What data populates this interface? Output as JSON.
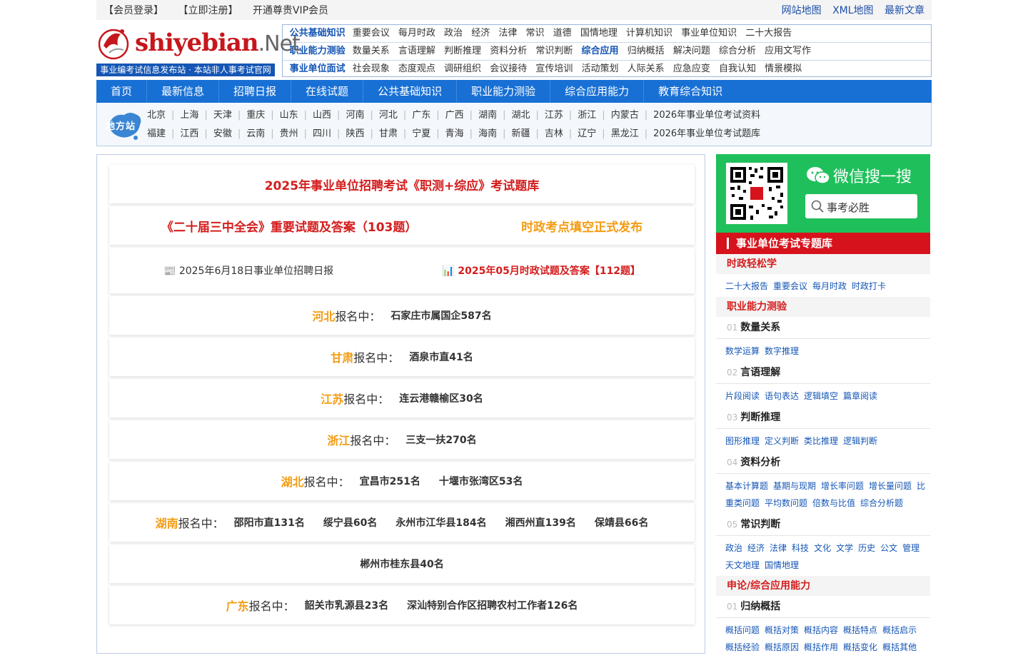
{
  "topbar": {
    "left": [
      "【会员登录】",
      "【立即注册】",
      "开通尊贵VIP会员"
    ],
    "right": [
      "网站地图",
      "XML地图",
      "最新文章"
    ]
  },
  "logo": {
    "main": "shiyebian",
    "suffix": ".Net",
    "subtitle": "事业编考试信息发布站 · 本站非人事考试官网"
  },
  "quicknav": [
    {
      "head": "公共基础知识",
      "items": [
        "重要会议",
        "每月时政",
        "政治",
        "经济",
        "法律",
        "常识",
        "道德",
        "国情地理",
        "计算机知识",
        "事业单位知识",
        "二十大报告"
      ]
    },
    {
      "head": "职业能力测验",
      "items": [
        "数量关系",
        "言语理解",
        "判断推理",
        "资料分析",
        "常识判断",
        "综合应用",
        "归纳概括",
        "解决问题",
        "综合分析",
        "应用文写作"
      ]
    },
    {
      "head": "事业单位面试",
      "items": [
        "社会现象",
        "态度观点",
        "调研组织",
        "会议接待",
        "宣传培训",
        "活动策划",
        "人际关系",
        "应急应变",
        "自我认知",
        "情景模拟"
      ]
    }
  ],
  "mainnav": [
    "首页",
    "最新信息",
    "招聘日报",
    "在线试题",
    "公共基础知识",
    "职业能力测验",
    "综合应用能力",
    "教育综合知识"
  ],
  "region": {
    "badge": "地方站",
    "row1": [
      "北京",
      "上海",
      "天津",
      "重庆",
      "山东",
      "山西",
      "河南",
      "河北",
      "广东",
      "广西",
      "湖南",
      "湖北",
      "江苏",
      "浙江",
      "内蒙古",
      "2026年事业单位考试资料"
    ],
    "row2": [
      "福建",
      "江西",
      "安徽",
      "云南",
      "贵州",
      "四川",
      "陕西",
      "甘肃",
      "宁夏",
      "青海",
      "海南",
      "新疆",
      "吉林",
      "辽宁",
      "黑龙江",
      "2026年事业单位考试题库"
    ]
  },
  "banners": {
    "b1": "2025年事业单位招聘考试《职测+综应》考试题库",
    "b2a": "《二十届三中全会》重要试题及答案（103题）",
    "b2b": "时政考点填空正式发布",
    "b3a": "2025年6月18日事业单位招聘日报",
    "b3b": "2025年05月时政试题及答案【112题】"
  },
  "status_label": "报名中：",
  "provinces": [
    {
      "name": "河北",
      "units": [
        "石家庄市属国企587名"
      ]
    },
    {
      "name": "甘肃",
      "units": [
        "酒泉市直41名"
      ]
    },
    {
      "name": "江苏",
      "units": [
        "连云港赣榆区30名"
      ]
    },
    {
      "name": "浙江",
      "units": [
        "三支一扶270名"
      ]
    },
    {
      "name": "湖北",
      "units": [
        "宜昌市251名",
        "十堰市张湾区53名"
      ]
    },
    {
      "name": "湖南",
      "units": [
        "邵阳市直131名",
        "绥宁县60名",
        "永州市江华县184名",
        "湘西州直139名",
        "保靖县66名"
      ]
    },
    {
      "name": "",
      "units": [
        "郴州市桂东县40名"
      ]
    },
    {
      "name": "广东",
      "units": [
        "韶关市乳源县23名",
        "深汕特别合作区招聘农村工作者126名"
      ]
    }
  ],
  "weixin": {
    "title": "微信搜一搜",
    "query": "事考必胜"
  },
  "sidebar": {
    "head": "事业单位考试专题库",
    "c1": "时政轻松学",
    "c1_links": [
      "二十大报告",
      "重要会议",
      "每月时政",
      "时政打卡"
    ],
    "c2": "职业能力测验",
    "s1": {
      "n": "01",
      "t": "数量关系",
      "links": [
        "数学运算",
        "数字推理"
      ]
    },
    "s2": {
      "n": "02",
      "t": "言语理解",
      "links": [
        "片段阅读",
        "语句表达",
        "逻辑填空",
        "篇章阅读"
      ]
    },
    "s3": {
      "n": "03",
      "t": "判断推理",
      "links": [
        "图形推理",
        "定义判断",
        "类比推理",
        "逻辑判断"
      ]
    },
    "s4": {
      "n": "04",
      "t": "资料分析",
      "links": [
        "基本计算题",
        "基期与现期",
        "增长率问题",
        "增长量问题",
        "比重类问题",
        "平均数问题",
        "倍数与比值",
        "综合分析题"
      ]
    },
    "s5": {
      "n": "05",
      "t": "常识判断",
      "links": [
        "政治",
        "经济",
        "法律",
        "科技",
        "文化",
        "文学",
        "历史",
        "公文",
        "管理",
        "天文地理",
        "国情地理"
      ]
    },
    "c3": "申论/综合应用能力",
    "s6": {
      "n": "01",
      "t": "归纳概括",
      "links": [
        "概括问题",
        "概括对策",
        "概括内容",
        "概括特点",
        "概括启示",
        "概括经验",
        "概括原因",
        "概括作用",
        "概括变化",
        "概括其他"
      ]
    }
  },
  "colors": {
    "brand_blue": "#1870d5",
    "brand_red": "#d6131c",
    "wechat_green": "#1fc05b",
    "accent_orange": "#f39c12"
  }
}
